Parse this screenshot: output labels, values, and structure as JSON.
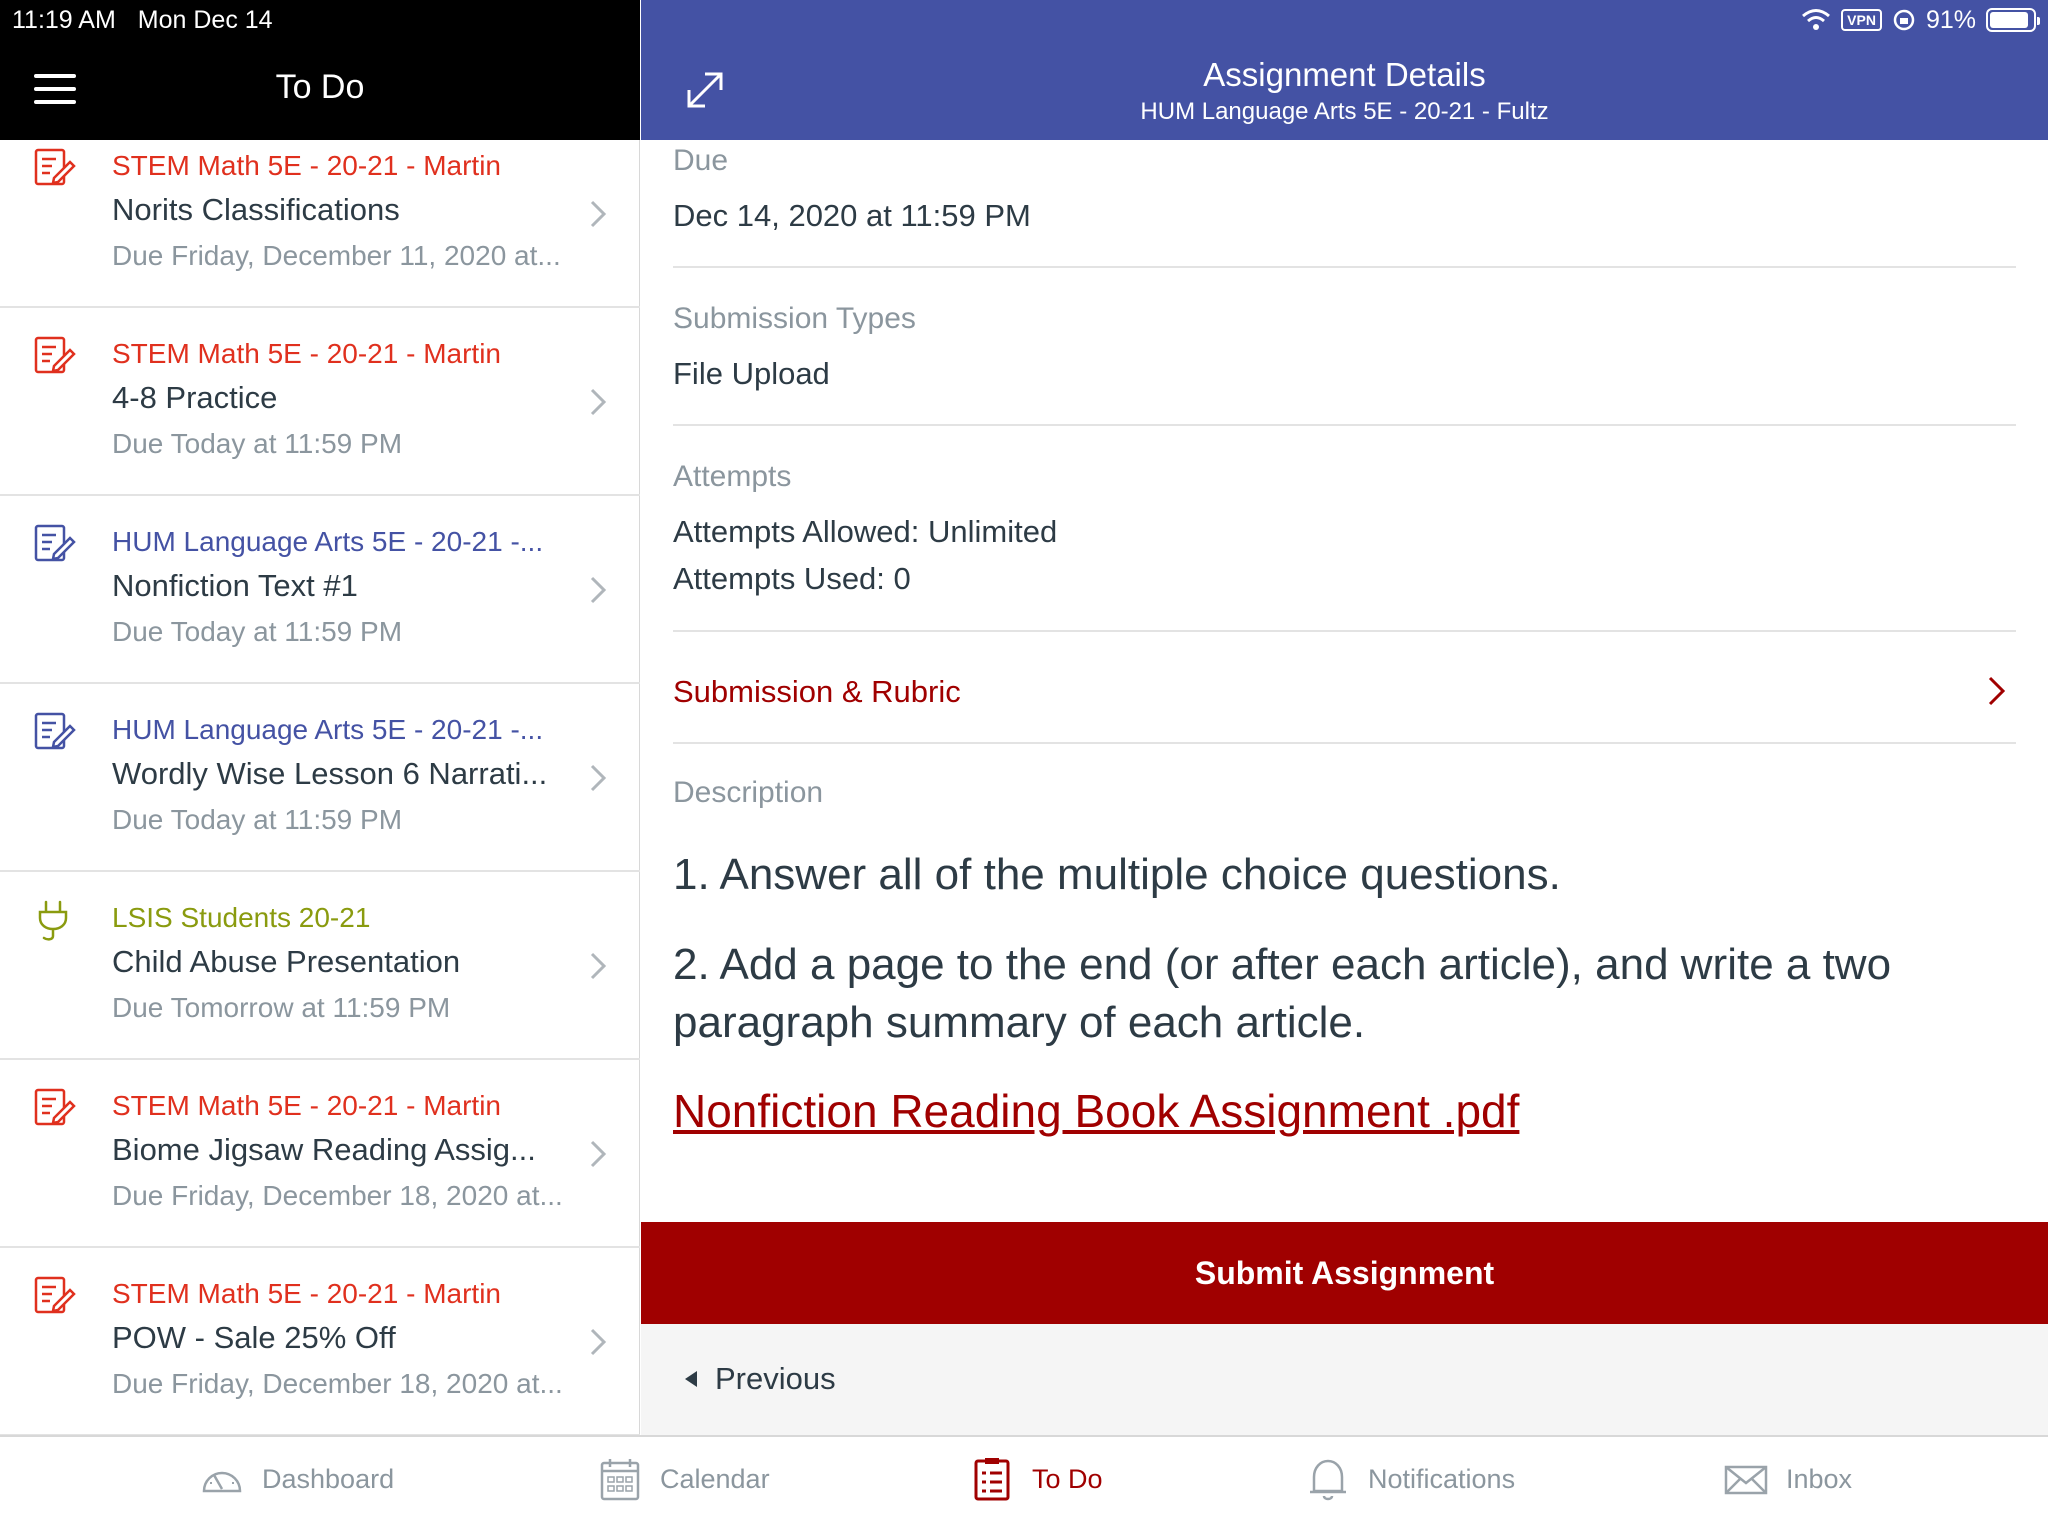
{
  "status_bar": {
    "time": "11:19 AM",
    "date": "Mon Dec 14",
    "vpn": "VPN",
    "battery": "91%",
    "battery_level": 0.91
  },
  "left_pane": {
    "title": "To Do",
    "items": [
      {
        "course": "STEM Math 5E - 20-21 - Martin",
        "course_color": "#e0301e",
        "title": "Norits Classifications",
        "due": "Due Friday, December 11, 2020 at...",
        "icon": "assignment-icon"
      },
      {
        "course": "STEM Math 5E - 20-21 - Martin",
        "course_color": "#e0301e",
        "title": "4-8 Practice",
        "due": "Due Today at 11:59 PM",
        "icon": "assignment-icon"
      },
      {
        "course": "HUM Language Arts 5E - 20-21 -...",
        "course_color": "#4452a4",
        "title": "Nonfiction Text #1",
        "due": "Due Today at 11:59 PM",
        "icon": "assignment-icon"
      },
      {
        "course": "HUM Language Arts 5E - 20-21 -...",
        "course_color": "#4452a4",
        "title": "Wordly Wise Lesson 6 Narrati...",
        "due": "Due Today at 11:59 PM",
        "icon": "assignment-icon"
      },
      {
        "course": "LSIS Students 20-21",
        "course_color": "#8a9b0f",
        "title": "Child Abuse Presentation",
        "due": "Due Tomorrow at 11:59 PM",
        "icon": "plug-icon"
      },
      {
        "course": "STEM Math 5E - 20-21 - Martin",
        "course_color": "#e0301e",
        "title": "Biome Jigsaw Reading Assig...",
        "due": "Due Friday, December 18, 2020 at...",
        "icon": "assignment-icon"
      },
      {
        "course": "STEM Math 5E - 20-21 - Martin",
        "course_color": "#e0301e",
        "title": "POW - Sale 25% Off",
        "due": "Due Friday, December 18, 2020 at...",
        "icon": "assignment-icon"
      }
    ]
  },
  "detail": {
    "header_title": "Assignment Details",
    "header_subtitle": "HUM Language Arts 5E - 20-21 - Fultz",
    "due_label": "Due",
    "due_value": "Dec 14, 2020 at 11:59 PM",
    "submission_types_label": "Submission Types",
    "submission_types_value": "File Upload",
    "attempts_label": "Attempts",
    "attempts_allowed_key": "Attempts Allowed:",
    "attempts_allowed_value": "Unlimited",
    "attempts_used_key": "Attempts Used:",
    "attempts_used_value": "0",
    "submission_rubric": "Submission & Rubric",
    "description_label": "Description",
    "description_p1": "1. Answer all of the multiple choice questions.",
    "description_p2": "2. Add a page to the end (or after each article), and write a two paragraph summary of each article.",
    "attachment_link": "Nonfiction Reading Book Assignment .pdf",
    "submit_button": "Submit Assignment",
    "previous_button": "Previous"
  },
  "tabbar": {
    "tabs": [
      {
        "label": "Dashboard",
        "icon": "dashboard-icon",
        "active": false
      },
      {
        "label": "Calendar",
        "icon": "calendar-icon",
        "active": false
      },
      {
        "label": "To Do",
        "icon": "todo-icon",
        "active": true
      },
      {
        "label": "Notifications",
        "icon": "bell-icon",
        "active": false
      },
      {
        "label": "Inbox",
        "icon": "mail-icon",
        "active": false
      }
    ]
  },
  "colors": {
    "header_blue": "#4452a4",
    "brand_red": "#a00000",
    "stem_red": "#e0301e",
    "lsis_green": "#8a9b0f"
  }
}
